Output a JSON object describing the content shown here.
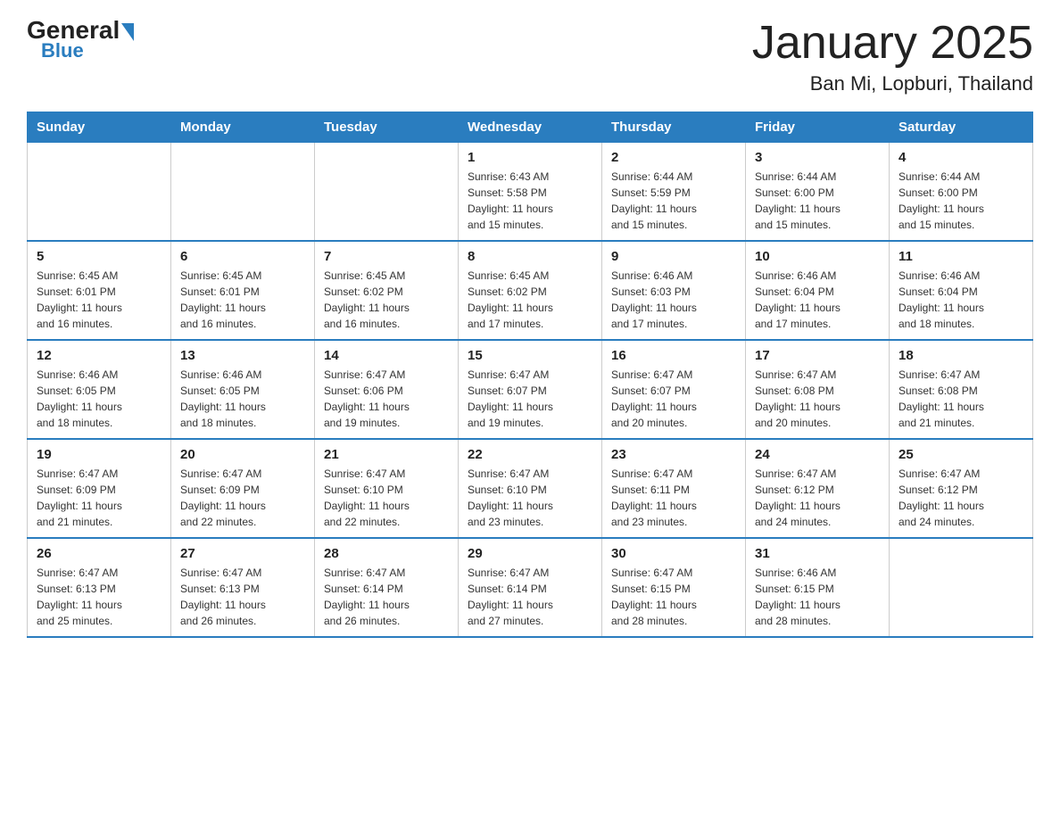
{
  "header": {
    "logo": {
      "general": "General",
      "blue": "Blue"
    },
    "title": "January 2025",
    "subtitle": "Ban Mi, Lopburi, Thailand"
  },
  "weekdays": [
    "Sunday",
    "Monday",
    "Tuesday",
    "Wednesday",
    "Thursday",
    "Friday",
    "Saturday"
  ],
  "weeks": [
    [
      {
        "day": "",
        "info": ""
      },
      {
        "day": "",
        "info": ""
      },
      {
        "day": "",
        "info": ""
      },
      {
        "day": "1",
        "info": "Sunrise: 6:43 AM\nSunset: 5:58 PM\nDaylight: 11 hours\nand 15 minutes."
      },
      {
        "day": "2",
        "info": "Sunrise: 6:44 AM\nSunset: 5:59 PM\nDaylight: 11 hours\nand 15 minutes."
      },
      {
        "day": "3",
        "info": "Sunrise: 6:44 AM\nSunset: 6:00 PM\nDaylight: 11 hours\nand 15 minutes."
      },
      {
        "day": "4",
        "info": "Sunrise: 6:44 AM\nSunset: 6:00 PM\nDaylight: 11 hours\nand 15 minutes."
      }
    ],
    [
      {
        "day": "5",
        "info": "Sunrise: 6:45 AM\nSunset: 6:01 PM\nDaylight: 11 hours\nand 16 minutes."
      },
      {
        "day": "6",
        "info": "Sunrise: 6:45 AM\nSunset: 6:01 PM\nDaylight: 11 hours\nand 16 minutes."
      },
      {
        "day": "7",
        "info": "Sunrise: 6:45 AM\nSunset: 6:02 PM\nDaylight: 11 hours\nand 16 minutes."
      },
      {
        "day": "8",
        "info": "Sunrise: 6:45 AM\nSunset: 6:02 PM\nDaylight: 11 hours\nand 17 minutes."
      },
      {
        "day": "9",
        "info": "Sunrise: 6:46 AM\nSunset: 6:03 PM\nDaylight: 11 hours\nand 17 minutes."
      },
      {
        "day": "10",
        "info": "Sunrise: 6:46 AM\nSunset: 6:04 PM\nDaylight: 11 hours\nand 17 minutes."
      },
      {
        "day": "11",
        "info": "Sunrise: 6:46 AM\nSunset: 6:04 PM\nDaylight: 11 hours\nand 18 minutes."
      }
    ],
    [
      {
        "day": "12",
        "info": "Sunrise: 6:46 AM\nSunset: 6:05 PM\nDaylight: 11 hours\nand 18 minutes."
      },
      {
        "day": "13",
        "info": "Sunrise: 6:46 AM\nSunset: 6:05 PM\nDaylight: 11 hours\nand 18 minutes."
      },
      {
        "day": "14",
        "info": "Sunrise: 6:47 AM\nSunset: 6:06 PM\nDaylight: 11 hours\nand 19 minutes."
      },
      {
        "day": "15",
        "info": "Sunrise: 6:47 AM\nSunset: 6:07 PM\nDaylight: 11 hours\nand 19 minutes."
      },
      {
        "day": "16",
        "info": "Sunrise: 6:47 AM\nSunset: 6:07 PM\nDaylight: 11 hours\nand 20 minutes."
      },
      {
        "day": "17",
        "info": "Sunrise: 6:47 AM\nSunset: 6:08 PM\nDaylight: 11 hours\nand 20 minutes."
      },
      {
        "day": "18",
        "info": "Sunrise: 6:47 AM\nSunset: 6:08 PM\nDaylight: 11 hours\nand 21 minutes."
      }
    ],
    [
      {
        "day": "19",
        "info": "Sunrise: 6:47 AM\nSunset: 6:09 PM\nDaylight: 11 hours\nand 21 minutes."
      },
      {
        "day": "20",
        "info": "Sunrise: 6:47 AM\nSunset: 6:09 PM\nDaylight: 11 hours\nand 22 minutes."
      },
      {
        "day": "21",
        "info": "Sunrise: 6:47 AM\nSunset: 6:10 PM\nDaylight: 11 hours\nand 22 minutes."
      },
      {
        "day": "22",
        "info": "Sunrise: 6:47 AM\nSunset: 6:10 PM\nDaylight: 11 hours\nand 23 minutes."
      },
      {
        "day": "23",
        "info": "Sunrise: 6:47 AM\nSunset: 6:11 PM\nDaylight: 11 hours\nand 23 minutes."
      },
      {
        "day": "24",
        "info": "Sunrise: 6:47 AM\nSunset: 6:12 PM\nDaylight: 11 hours\nand 24 minutes."
      },
      {
        "day": "25",
        "info": "Sunrise: 6:47 AM\nSunset: 6:12 PM\nDaylight: 11 hours\nand 24 minutes."
      }
    ],
    [
      {
        "day": "26",
        "info": "Sunrise: 6:47 AM\nSunset: 6:13 PM\nDaylight: 11 hours\nand 25 minutes."
      },
      {
        "day": "27",
        "info": "Sunrise: 6:47 AM\nSunset: 6:13 PM\nDaylight: 11 hours\nand 26 minutes."
      },
      {
        "day": "28",
        "info": "Sunrise: 6:47 AM\nSunset: 6:14 PM\nDaylight: 11 hours\nand 26 minutes."
      },
      {
        "day": "29",
        "info": "Sunrise: 6:47 AM\nSunset: 6:14 PM\nDaylight: 11 hours\nand 27 minutes."
      },
      {
        "day": "30",
        "info": "Sunrise: 6:47 AM\nSunset: 6:15 PM\nDaylight: 11 hours\nand 28 minutes."
      },
      {
        "day": "31",
        "info": "Sunrise: 6:46 AM\nSunset: 6:15 PM\nDaylight: 11 hours\nand 28 minutes."
      },
      {
        "day": "",
        "info": ""
      }
    ]
  ]
}
